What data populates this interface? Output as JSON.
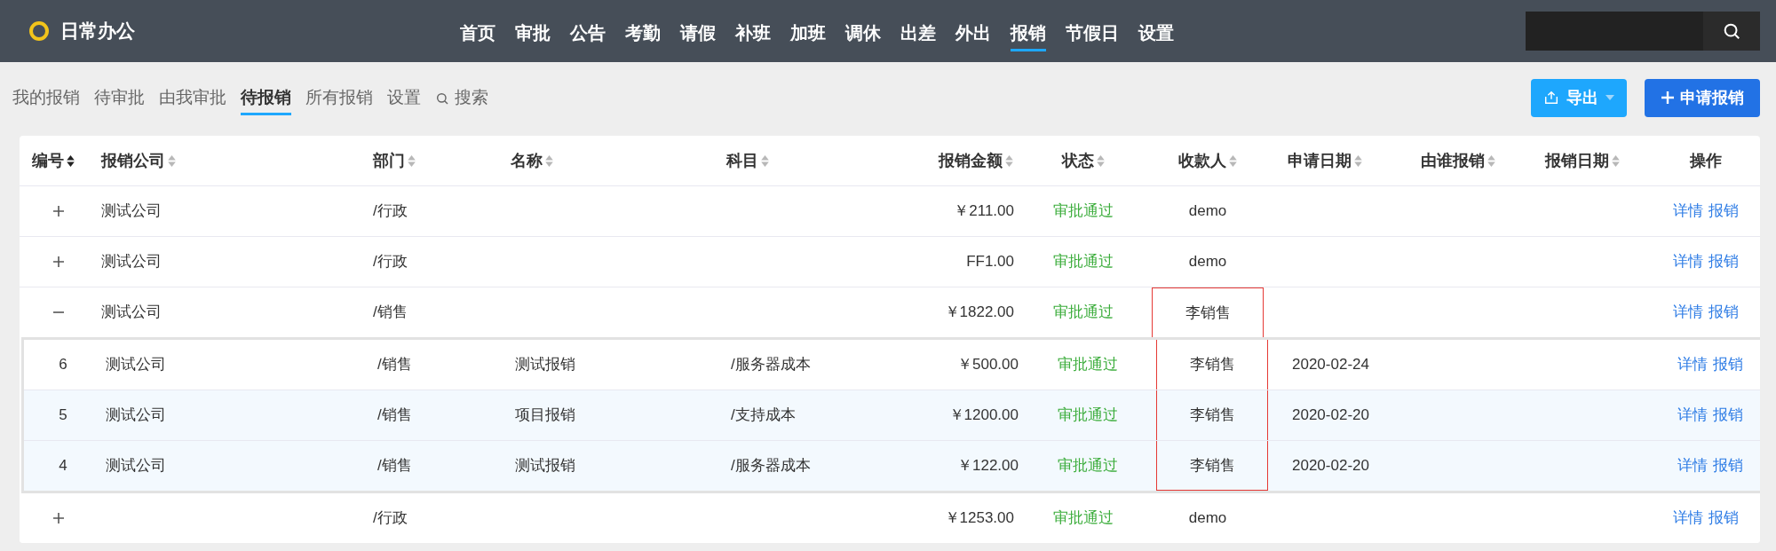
{
  "app": {
    "title": "日常办公"
  },
  "nav": [
    {
      "label": "首页",
      "selected": false
    },
    {
      "label": "审批",
      "selected": false
    },
    {
      "label": "公告",
      "selected": false
    },
    {
      "label": "考勤",
      "selected": false
    },
    {
      "label": "请假",
      "selected": false
    },
    {
      "label": "补班",
      "selected": false
    },
    {
      "label": "加班",
      "selected": false
    },
    {
      "label": "调休",
      "selected": false
    },
    {
      "label": "出差",
      "selected": false
    },
    {
      "label": "外出",
      "selected": false
    },
    {
      "label": "报销",
      "selected": true
    },
    {
      "label": "节假日",
      "selected": false
    },
    {
      "label": "设置",
      "selected": false
    }
  ],
  "subnav": [
    {
      "label": "我的报销",
      "kind": "tab",
      "selected": false
    },
    {
      "label": "待审批",
      "kind": "tab",
      "selected": false
    },
    {
      "label": "由我审批",
      "kind": "tab",
      "selected": false
    },
    {
      "label": "待报销",
      "kind": "tab",
      "selected": true
    },
    {
      "label": "所有报销",
      "kind": "tab",
      "selected": false
    },
    {
      "label": "设置",
      "kind": "tab",
      "selected": false
    },
    {
      "label": "搜索",
      "kind": "search",
      "selected": false
    }
  ],
  "actions": {
    "export": "导出",
    "create": "申请报销"
  },
  "table": {
    "columns": [
      {
        "label": "编号",
        "sortable": true,
        "sorted": true
      },
      {
        "label": "报销公司",
        "sortable": true,
        "sorted": false
      },
      {
        "label": "部门",
        "sortable": true,
        "sorted": false
      },
      {
        "label": "名称",
        "sortable": true,
        "sorted": false
      },
      {
        "label": "科目",
        "sortable": true,
        "sorted": false
      },
      {
        "label": "报销金额",
        "sortable": true,
        "sorted": false
      },
      {
        "label": "状态",
        "sortable": true,
        "sorted": false
      },
      {
        "label": "收款人",
        "sortable": true,
        "sorted": false
      },
      {
        "label": "申请日期",
        "sortable": true,
        "sorted": false
      },
      {
        "label": "由谁报销",
        "sortable": true,
        "sorted": false
      },
      {
        "label": "报销日期",
        "sortable": true,
        "sorted": false
      },
      {
        "label": "操作",
        "sortable": false
      }
    ],
    "rows": [
      {
        "expanded": false,
        "company": "测试公司",
        "department": "/行政",
        "amount": "￥211.00",
        "status": "审批通过",
        "payee": "demo",
        "payee_marked": false,
        "links": [
          "详情",
          "报销"
        ]
      },
      {
        "expanded": false,
        "company": "测试公司",
        "department": "/行政",
        "amount": "FF1.00",
        "status": "审批通过",
        "payee": "demo",
        "payee_marked": false,
        "links": [
          "详情",
          "报销"
        ]
      },
      {
        "expanded": true,
        "company": "测试公司",
        "department": "/销售",
        "amount": "￥1822.00",
        "status": "审批通过",
        "payee": "李销售",
        "payee_marked": true,
        "links": [
          "详情",
          "报销"
        ],
        "children": [
          {
            "id": "6",
            "shaded": false,
            "company": "测试公司",
            "department": "/销售",
            "name": "测试报销",
            "subject": "/服务器成本",
            "amount": "￥500.00",
            "status": "审批通过",
            "payee": "李销售",
            "payee_marked": true,
            "apply_date": "2020-02-24",
            "links": [
              "详情",
              "报销"
            ]
          },
          {
            "id": "5",
            "shaded": true,
            "company": "测试公司",
            "department": "/销售",
            "name": "项目报销",
            "subject": "/支持成本",
            "amount": "￥1200.00",
            "status": "审批通过",
            "payee": "李销售",
            "payee_marked": true,
            "apply_date": "2020-02-20",
            "links": [
              "详情",
              "报销"
            ]
          },
          {
            "id": "4",
            "shaded": true,
            "company": "测试公司",
            "department": "/销售",
            "name": "测试报销",
            "subject": "/服务器成本",
            "amount": "￥122.00",
            "status": "审批通过",
            "payee": "李销售",
            "payee_marked": true,
            "apply_date": "2020-02-20",
            "links": [
              "详情",
              "报销"
            ]
          }
        ]
      },
      {
        "expanded": false,
        "department": "/行政",
        "amount": "￥1253.00",
        "status": "审批通过",
        "payee": "demo",
        "payee_marked": false,
        "links": [
          "详情",
          "报销"
        ]
      }
    ]
  }
}
